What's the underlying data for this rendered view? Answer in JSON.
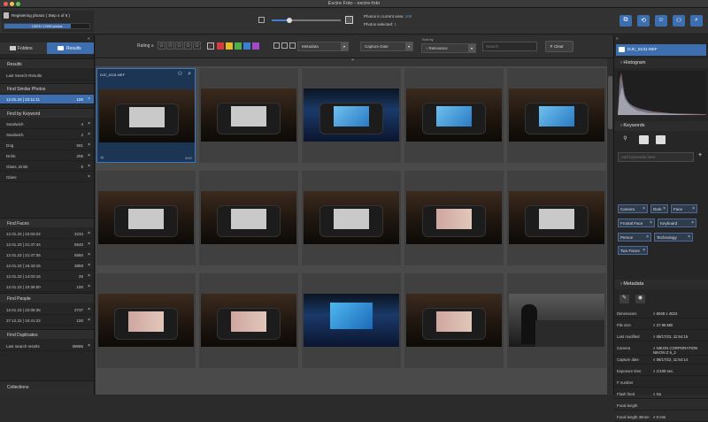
{
  "window": {
    "title": "Excire Foto - excire-foto"
  },
  "progress": {
    "title": "Registering photos ( Step 4 of 5 )",
    "value_text": "13875 / 17690 photos",
    "fraction": 0.78
  },
  "view_info": {
    "photos_in_view_label": "Photos in current view:",
    "photos_in_view_value": "100",
    "photos_selected_label": "Photos selected:",
    "photos_selected_value": "1"
  },
  "left_tabs": {
    "folders": "Folders",
    "results": "Results"
  },
  "results": {
    "header": "Results",
    "last_search": "Last Search Results",
    "similar": {
      "header": "Find Similar Photos",
      "items": [
        {
          "label": "12.01.23 | 22:11:11",
          "count": "100"
        }
      ]
    },
    "keyword": {
      "header": "Find by Keyword",
      "items": [
        {
          "label": "Sandwich",
          "count": "4"
        },
        {
          "label": "Sandwich",
          "count": "4"
        },
        {
          "label": "Dog",
          "count": "591"
        },
        {
          "label": "Drink",
          "count": "205"
        },
        {
          "label": "Glass, Drink",
          "count": "6"
        },
        {
          "label": "Glass",
          "count": ""
        }
      ]
    },
    "faces": {
      "header": "Find Faces",
      "items": [
        {
          "label": "12.01.23 | 22:03:22",
          "count": "2234"
        },
        {
          "label": "12.01.23 | 21:47:44",
          "count": "5540"
        },
        {
          "label": "12.01.23 | 21:47:36",
          "count": "5560"
        },
        {
          "label": "12.01.23 | 16:43:15",
          "count": "3859"
        },
        {
          "label": "12.01.23 | 14:03:16",
          "count": "25"
        },
        {
          "label": "12.01.23 | 10:36:00",
          "count": "100"
        }
      ]
    },
    "people": {
      "header": "Find People",
      "items": [
        {
          "label": "12.01.23 | 22:05:35",
          "count": "2737"
        },
        {
          "label": "27.12.22 | 10:41:22",
          "count": "100"
        }
      ]
    },
    "duplicates": {
      "header": "Find Duplicates",
      "items": [
        {
          "label": "Last search results",
          "count": "39686"
        }
      ]
    },
    "collections": "Collections"
  },
  "filters": {
    "rating_label": "Rating",
    "rating_op": "≥",
    "stars": 0,
    "color_labels": [
      "#d63b3b",
      "#e3b92a",
      "#4bb04b",
      "#3a7fd4",
      "#a24bc8"
    ],
    "metadata": "Metadata",
    "capture_date": "Capture Date",
    "sort_by_label": "Sort by",
    "sort_value": "Relevance",
    "search_placeholder": "Search",
    "clear": "Clear"
  },
  "grid": {
    "selected_caption": "DJC_5131.NEF",
    "selected_footer": "5/4/0",
    "cells": [
      {
        "kind": "gray"
      },
      {
        "kind": "gray"
      },
      {
        "kind": "blue"
      },
      {
        "kind": "blue"
      },
      {
        "kind": "blue"
      },
      {
        "kind": "gray"
      },
      {
        "kind": "gray"
      },
      {
        "kind": "gray"
      },
      {
        "kind": "pink"
      },
      {
        "kind": "gray"
      },
      {
        "kind": "pink"
      },
      {
        "kind": "pink"
      },
      {
        "kind": "bigblue"
      },
      {
        "kind": "pink"
      },
      {
        "kind": "studio"
      }
    ]
  },
  "right": {
    "filename": "DJC_5131.NEF",
    "histogram": "Histogram",
    "keywords": "Keywords",
    "add_keywords_placeholder": "Add keywords here",
    "tags": [
      "Camera",
      "Dark",
      "Face",
      "Frontal Face",
      "Keyboard",
      "Person",
      "Technology",
      "Two Faces"
    ],
    "metadata_header": "Metadata",
    "meta": [
      {
        "k": "Dimensions",
        "v": "6048 x 4024"
      },
      {
        "k": "File size",
        "v": "27.95 MB"
      },
      {
        "k": "Last modified",
        "v": "08/17/22, 11:54:15"
      },
      {
        "k": "Camera",
        "v": "NIKON CORPORATION NIKON Z 6_2"
      },
      {
        "k": "Capture date",
        "v": "08/17/22, 11:54:14"
      },
      {
        "k": "Exposure time",
        "v": "1/100 sec."
      },
      {
        "k": "F number",
        "v": ""
      },
      {
        "k": "Flash fired",
        "v": "No"
      },
      {
        "k": "Focal length",
        "v": ""
      },
      {
        "k": "Focal length 35mm",
        "v": "0 mm"
      }
    ]
  }
}
